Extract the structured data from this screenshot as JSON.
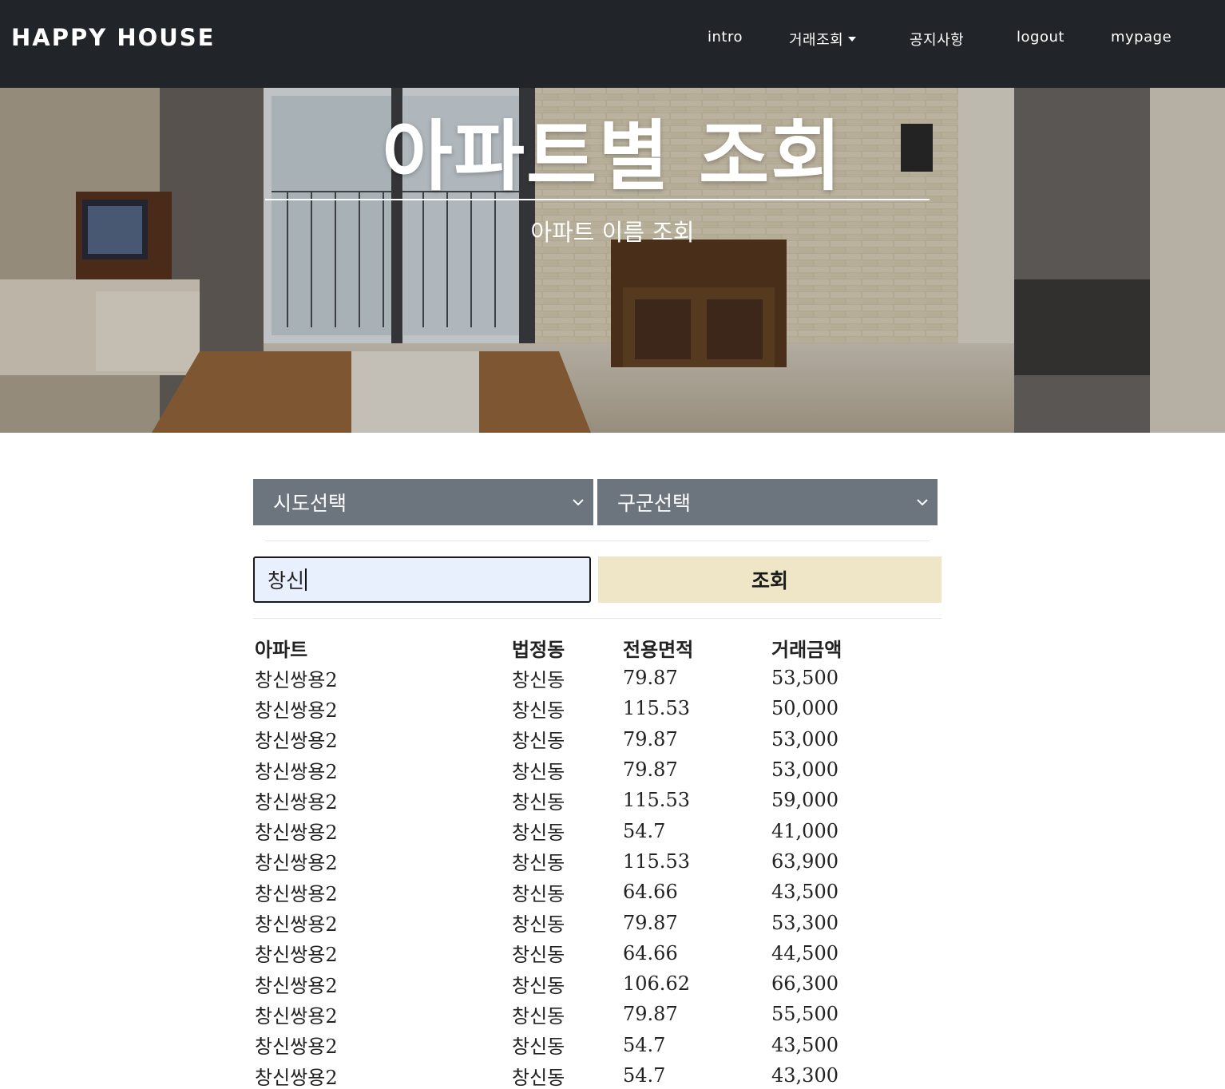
{
  "navbar": {
    "brand": "HAPPY HOUSE",
    "items": [
      {
        "label": "intro"
      },
      {
        "label": "거래조회"
      },
      {
        "label": "공지사항"
      },
      {
        "label": "logout"
      },
      {
        "label": "mypage"
      }
    ]
  },
  "hero": {
    "title": "아파트별 조회",
    "subtitle": "아파트 이름 조회"
  },
  "filters": {
    "sido": {
      "selected": "시도선택"
    },
    "gugun": {
      "selected": "구군선택"
    }
  },
  "search": {
    "value": "창신",
    "button_label": "조회"
  },
  "table": {
    "columns": [
      "아파트",
      "법정동",
      "전용면적",
      "거래금액"
    ],
    "rows": [
      [
        "창신쌍용2",
        "창신동",
        "79.87",
        "53,500"
      ],
      [
        "창신쌍용2",
        "창신동",
        "115.53",
        "50,000"
      ],
      [
        "창신쌍용2",
        "창신동",
        "79.87",
        "53,000"
      ],
      [
        "창신쌍용2",
        "창신동",
        "79.87",
        "53,000"
      ],
      [
        "창신쌍용2",
        "창신동",
        "115.53",
        "59,000"
      ],
      [
        "창신쌍용2",
        "창신동",
        "54.7",
        "41,000"
      ],
      [
        "창신쌍용2",
        "창신동",
        "115.53",
        "63,900"
      ],
      [
        "창신쌍용2",
        "창신동",
        "64.66",
        "43,500"
      ],
      [
        "창신쌍용2",
        "창신동",
        "79.87",
        "53,300"
      ],
      [
        "창신쌍용2",
        "창신동",
        "64.66",
        "44,500"
      ],
      [
        "창신쌍용2",
        "창신동",
        "106.62",
        "66,300"
      ],
      [
        "창신쌍용2",
        "창신동",
        "79.87",
        "55,500"
      ],
      [
        "창신쌍용2",
        "창신동",
        "54.7",
        "43,500"
      ],
      [
        "창신쌍용2",
        "창신동",
        "54.7",
        "43,300"
      ]
    ]
  }
}
